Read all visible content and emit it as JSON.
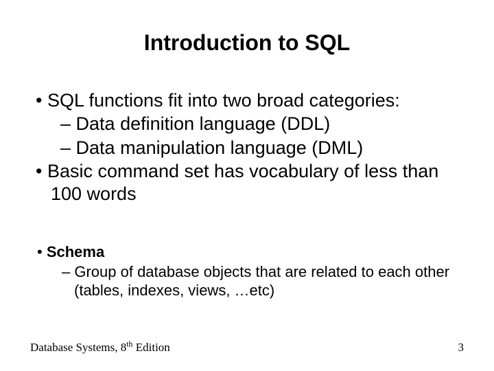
{
  "title": "Introduction to SQL",
  "bullets": {
    "p1": "SQL functions fit into two broad categories:",
    "p1a": "Data definition language (DDL)",
    "p1b": "Data manipulation language (DML)",
    "p2": "Basic command set has vocabulary of less than 100 words"
  },
  "section2": {
    "s1": "Schema",
    "s1a": "Group of database objects that are related to each other (tables, indexes, views, …etc)"
  },
  "footer": {
    "text_before_sup": "Database Systems, 8",
    "sup": "th",
    "text_after_sup": " Edition",
    "page": "3"
  }
}
